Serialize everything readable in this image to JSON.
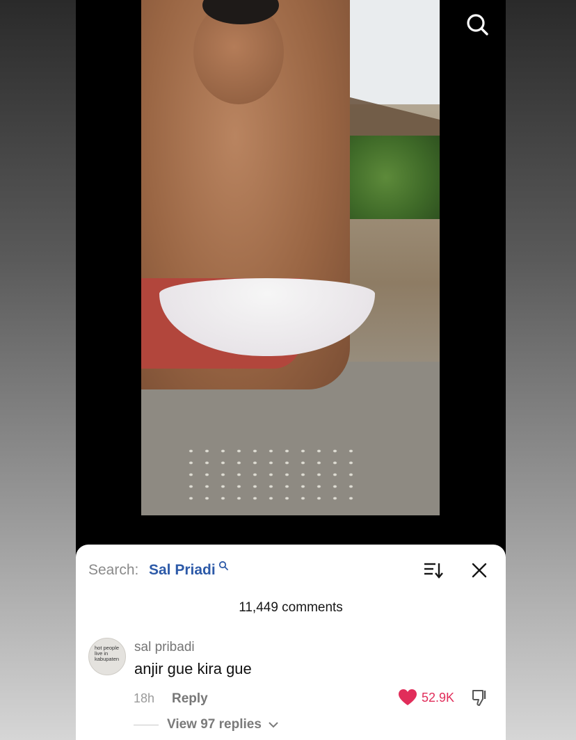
{
  "header": {
    "search_icon": "search-icon"
  },
  "comments_sheet": {
    "search_label": "Search:",
    "search_term": "Sal Priadi",
    "comment_count": "11,449 comments",
    "icons": {
      "sort": "sort-icon",
      "close": "close-icon"
    }
  },
  "comment": {
    "avatar_lines": [
      "hot people",
      "live in",
      "kabupaten"
    ],
    "username": "sal pribadi",
    "text": "anjir gue kira gue",
    "time": "18h",
    "reply_label": "Reply",
    "likes": "52.9K",
    "liked": true,
    "view_replies": "View 97 replies"
  },
  "colors": {
    "accent_link": "#2d5aa8",
    "like_red": "#e12d5a"
  }
}
